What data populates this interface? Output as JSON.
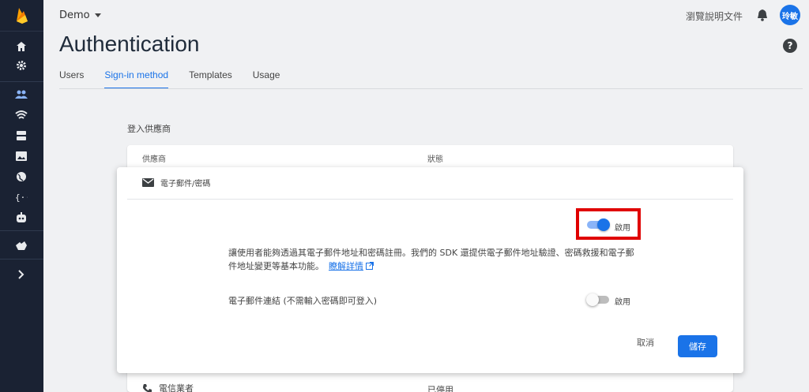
{
  "header": {
    "project_name": "Demo",
    "docs_link": "瀏覽說明文件",
    "avatar_initials": "玲敏",
    "page_title": "Authentication",
    "help_glyph": "?"
  },
  "tabs": [
    {
      "label": "Users",
      "active": false
    },
    {
      "label": "Sign-in method",
      "active": true
    },
    {
      "label": "Templates",
      "active": false
    },
    {
      "label": "Usage",
      "active": false
    }
  ],
  "providers": {
    "section_title": "登入供應商",
    "col_provider": "供應商",
    "col_status": "狀態",
    "bottom_row": {
      "name": "電信業者",
      "status": "已停用"
    }
  },
  "panel": {
    "provider_name": "電子郵件/密碼",
    "enable_label": "啟用",
    "enabled": true,
    "description": "讓使用者能夠透過其電子郵件地址和密碼註冊。我們的 SDK 還提供電子郵件地址驗證、密碼救援和電子郵件地址變更等基本功能。",
    "learn_more": "瞭解詳情",
    "email_link_label": "電子郵件連結 (不需輸入密碼即可登入)",
    "email_link_enable_label": "啟用",
    "email_link_enabled": false,
    "cancel_label": "取消",
    "save_label": "儲存"
  },
  "colors": {
    "sidebar": "#1a2233",
    "accent": "#1a73e8",
    "highlight": "#e00000"
  },
  "icons": {
    "sidebar": [
      "firebase-logo",
      "home-icon",
      "gear-icon",
      "users-icon",
      "wifi-icon",
      "database-icon",
      "image-icon",
      "globe-icon",
      "functions-icon",
      "robot-icon",
      "extension-icon",
      "chevron-right-icon"
    ]
  }
}
